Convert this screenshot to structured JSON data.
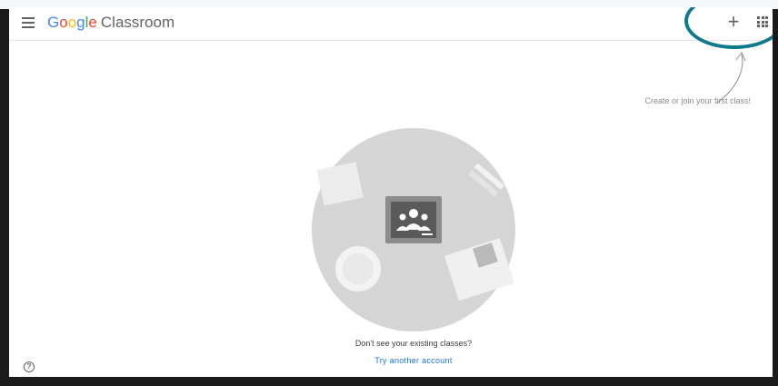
{
  "header": {
    "brand_letters": [
      "G",
      "o",
      "o",
      "g",
      "l",
      "e"
    ],
    "product_name": "Classroom",
    "add_label": "+"
  },
  "hint": {
    "text": "Create or join your first class!"
  },
  "empty_state": {
    "question": "Don't see your existing classes?",
    "link_label": "Try another account"
  },
  "footer": {
    "help_label": "?"
  },
  "colors": {
    "accent_ring": "#0e7a8b",
    "link": "#1a73e8",
    "illustration_circle": "#d5d5d5"
  }
}
